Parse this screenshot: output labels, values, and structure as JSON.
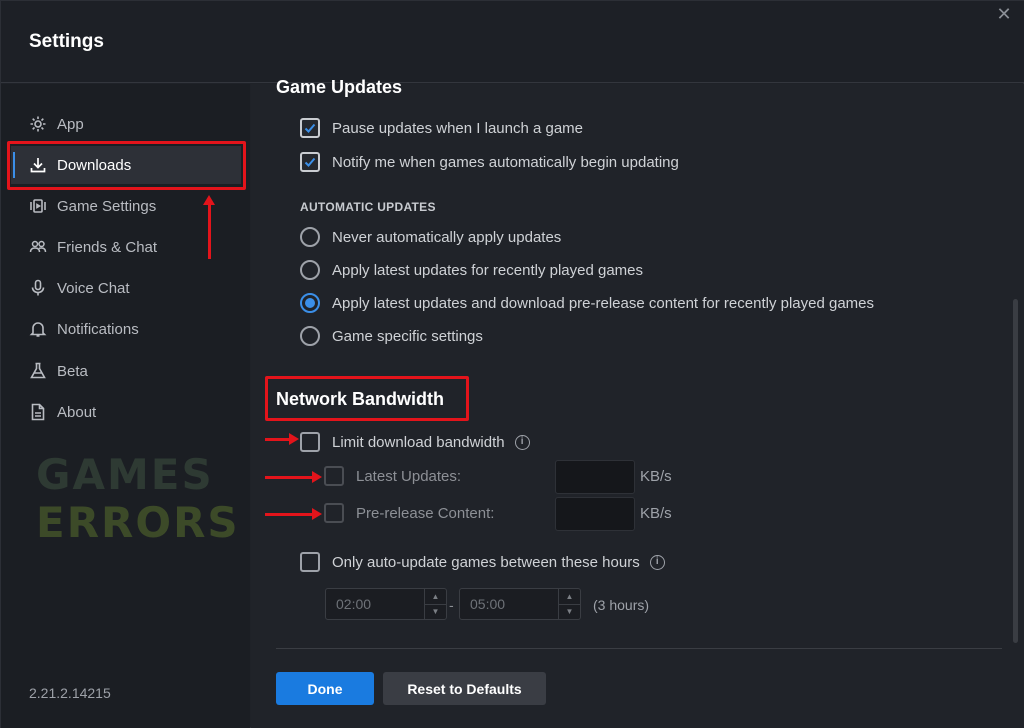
{
  "window": {
    "title": "Settings",
    "close_glyph": "✕"
  },
  "sidebar": {
    "items": [
      {
        "label": "App",
        "icon": "gear-icon"
      },
      {
        "label": "Downloads",
        "icon": "download-icon",
        "active": true
      },
      {
        "label": "Game Settings",
        "icon": "game-settings-icon"
      },
      {
        "label": "Friends & Chat",
        "icon": "friends-icon"
      },
      {
        "label": "Voice Chat",
        "icon": "microphone-icon"
      },
      {
        "label": "Notifications",
        "icon": "bell-icon"
      },
      {
        "label": "Beta",
        "icon": "flask-icon"
      },
      {
        "label": "About",
        "icon": "document-icon"
      }
    ],
    "version": "2.21.2.14215"
  },
  "watermark": {
    "line1": "GAMES",
    "line2": "ERRORS"
  },
  "game_updates": {
    "heading": "Game Updates",
    "pause_label": "Pause updates when I launch a game",
    "pause_checked": true,
    "notify_label": "Notify me when games automatically begin updating",
    "notify_checked": true,
    "auto_label": "AUTOMATIC UPDATES",
    "options": [
      {
        "label": "Never automatically apply updates",
        "selected": false
      },
      {
        "label": "Apply latest updates for recently played games",
        "selected": false
      },
      {
        "label": "Apply latest updates and download pre-release content for recently played games",
        "selected": true
      },
      {
        "label": "Game specific settings",
        "selected": false
      }
    ]
  },
  "network": {
    "heading": "Network Bandwidth",
    "limit_label": "Limit download bandwidth",
    "limit_checked": false,
    "latest_label": "Latest Updates:",
    "latest_value": "",
    "prerelease_label": "Pre-release Content:",
    "prerelease_value": "",
    "unit": "KB/s",
    "info_glyph": "i",
    "hours_label": "Only auto-update games between these hours",
    "hours_checked": false,
    "start_time": "02:00",
    "end_time": "05:00",
    "separator": "-",
    "duration": "(3 hours)",
    "spin_up": "▲",
    "spin_down": "▼"
  },
  "footer": {
    "done_label": "Done",
    "reset_label": "Reset to Defaults"
  },
  "colors": {
    "accent": "#1a7be0",
    "highlight": "#e3141b"
  }
}
